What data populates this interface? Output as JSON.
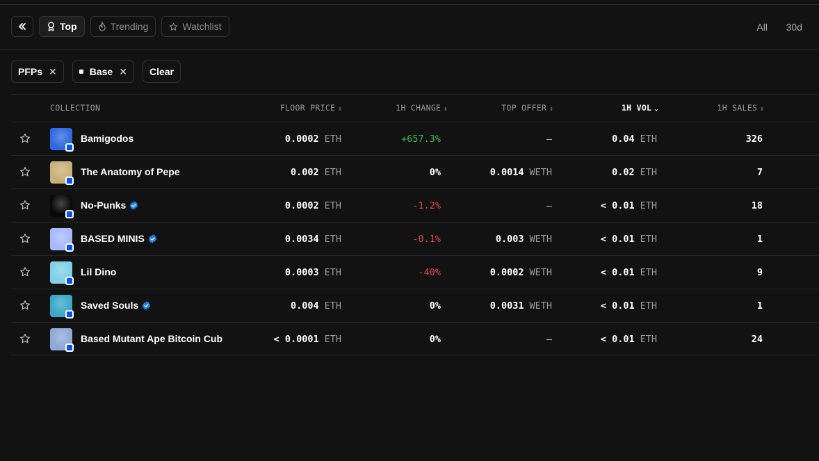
{
  "nav": {
    "tabs": [
      {
        "label": "Top",
        "icon": "medal-icon",
        "active": true
      },
      {
        "label": "Trending",
        "icon": "flame-icon",
        "active": false
      },
      {
        "label": "Watchlist",
        "icon": "star-icon",
        "active": false
      }
    ],
    "ranges": [
      "All",
      "30d"
    ]
  },
  "filters": {
    "chips": [
      {
        "label": "PFPs"
      },
      {
        "label": "Base"
      }
    ],
    "clear_label": "Clear"
  },
  "table": {
    "headers": {
      "collection": "COLLECTION",
      "floor_price": "FLOOR PRICE",
      "change": "1H CHANGE",
      "top_offer": "TOP OFFER",
      "volume": "1H VOL",
      "sales": "1H SALES"
    },
    "rows": [
      {
        "name": "Bamigodos",
        "verified": false,
        "floor": "0.0002",
        "floor_unit": "ETH",
        "change": "+657.3%",
        "change_dir": "pos",
        "offer": "—",
        "offer_unit": "",
        "vol": "0.04",
        "vol_unit": "ETH",
        "sales": "326",
        "avatar_color": "#2f6ae0"
      },
      {
        "name": "The Anatomy of Pepe",
        "verified": false,
        "floor": "0.002",
        "floor_unit": "ETH",
        "change": "0%",
        "change_dir": "neu",
        "offer": "0.0014",
        "offer_unit": "WETH",
        "vol": "0.02",
        "vol_unit": "ETH",
        "sales": "7",
        "avatar_color": "#c9b078"
      },
      {
        "name": "No-Punks",
        "verified": true,
        "floor": "0.0002",
        "floor_unit": "ETH",
        "change": "-1.2%",
        "change_dir": "neg",
        "offer": "—",
        "offer_unit": "",
        "vol": "< 0.01",
        "vol_unit": "ETH",
        "sales": "18",
        "avatar_color": "#0a0a0a"
      },
      {
        "name": "BASED MINIS",
        "verified": true,
        "floor": "0.0034",
        "floor_unit": "ETH",
        "change": "-0.1%",
        "change_dir": "neg",
        "offer": "0.003",
        "offer_unit": "WETH",
        "vol": "< 0.01",
        "vol_unit": "ETH",
        "sales": "1",
        "avatar_color": "#a9b8ff"
      },
      {
        "name": "Lil Dino",
        "verified": false,
        "floor": "0.0003",
        "floor_unit": "ETH",
        "change": "-40%",
        "change_dir": "neg",
        "offer": "0.0002",
        "offer_unit": "WETH",
        "vol": "< 0.01",
        "vol_unit": "ETH",
        "sales": "9",
        "avatar_color": "#7fd0e8"
      },
      {
        "name": "Saved Souls",
        "verified": true,
        "floor": "0.004",
        "floor_unit": "ETH",
        "change": "0%",
        "change_dir": "neu",
        "offer": "0.0031",
        "offer_unit": "WETH",
        "vol": "< 0.01",
        "vol_unit": "ETH",
        "sales": "1",
        "avatar_color": "#3aa8c8"
      },
      {
        "name": "Based Mutant Ape Bitcoin Cub",
        "verified": false,
        "floor": "< 0.0001",
        "floor_unit": "ETH",
        "change": "0%",
        "change_dir": "neu",
        "offer": "—",
        "offer_unit": "",
        "vol": "< 0.01",
        "vol_unit": "ETH",
        "sales": "24",
        "avatar_color": "#8fa9d6"
      }
    ]
  },
  "colors": {
    "positive": "#3fb950",
    "negative": "#e5484d",
    "base_chain": "#0052ff",
    "verified": "#2081e2"
  }
}
